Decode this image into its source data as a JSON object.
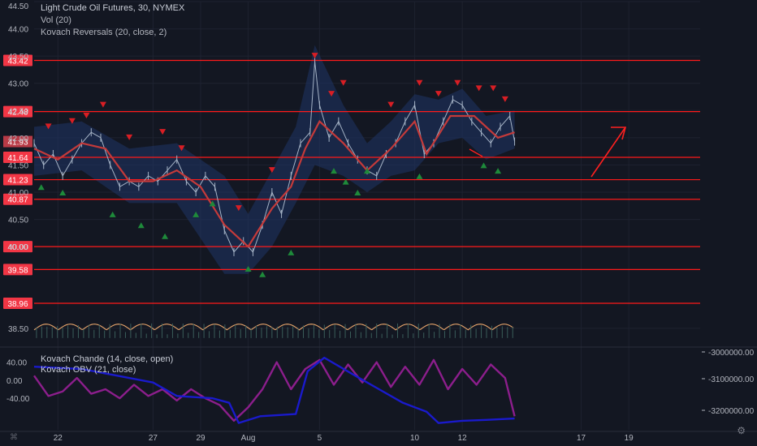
{
  "header": {
    "symbol_line": "Light Crude Oil Futures, 30, NYMEX",
    "vol_line": "Vol (20)",
    "reversals_line": "Kovach Reversals (20, close, 2)"
  },
  "sub_legend": {
    "chande": "Kovach Chande (14, close, open)",
    "obv": "Kovach OBV (21, close)"
  },
  "colors": {
    "background": "#131722",
    "grid": "#1e2230",
    "price_up": "#a5b3c6",
    "level_line": "#ff1a1a",
    "level_badge": "#f23645",
    "trend_line": "#c43a3a",
    "band": "#1f3566",
    "up_marker": "#1e8a3a",
    "down_marker": "#d81e24",
    "volume_wave": "#e8a56b",
    "chande_line": "#8c1e8c",
    "obv_line": "#1a1acc",
    "axis_text": "#b2b5be"
  },
  "chart_data": {
    "type": "line",
    "title": "Light Crude Oil Futures, 30, NYMEX",
    "price_axis": {
      "ylim": [
        38.2,
        44.5
      ],
      "ticks": [
        "44.50",
        "44.00",
        "43.50",
        "43.00",
        "42.50",
        "42.00",
        "41.50",
        "41.00",
        "40.50",
        "40.00",
        "38.50"
      ]
    },
    "x_ticks": [
      {
        "label": "22",
        "x": 1
      },
      {
        "label": "27",
        "x": 5
      },
      {
        "label": "29",
        "x": 7
      },
      {
        "label": "Aug",
        "x": 9
      },
      {
        "label": "5",
        "x": 12
      },
      {
        "label": "10",
        "x": 16
      },
      {
        "label": "12",
        "x": 18
      },
      {
        "label": "17",
        "x": 23
      },
      {
        "label": "19",
        "x": 25
      }
    ],
    "xlim": [
      0,
      28
    ],
    "horizontal_levels": [
      "43.42",
      "42.48",
      "41.64",
      "41.23",
      "40.87",
      "40.00",
      "39.58",
      "38.96"
    ],
    "last_price": "41.93",
    "price_series": [
      {
        "x": 0.0,
        "y": 41.9
      },
      {
        "x": 0.4,
        "y": 41.5
      },
      {
        "x": 0.8,
        "y": 41.7
      },
      {
        "x": 1.2,
        "y": 41.3
      },
      {
        "x": 1.6,
        "y": 41.6
      },
      {
        "x": 2.0,
        "y": 41.9
      },
      {
        "x": 2.4,
        "y": 42.1
      },
      {
        "x": 2.8,
        "y": 42.0
      },
      {
        "x": 3.2,
        "y": 41.5
      },
      {
        "x": 3.6,
        "y": 41.1
      },
      {
        "x": 4.0,
        "y": 41.2
      },
      {
        "x": 4.4,
        "y": 41.1
      },
      {
        "x": 4.8,
        "y": 41.3
      },
      {
        "x": 5.2,
        "y": 41.2
      },
      {
        "x": 5.6,
        "y": 41.4
      },
      {
        "x": 6.0,
        "y": 41.6
      },
      {
        "x": 6.4,
        "y": 41.2
      },
      {
        "x": 6.8,
        "y": 41.0
      },
      {
        "x": 7.2,
        "y": 41.3
      },
      {
        "x": 7.6,
        "y": 41.1
      },
      {
        "x": 8.0,
        "y": 40.3
      },
      {
        "x": 8.4,
        "y": 39.9
      },
      {
        "x": 8.8,
        "y": 40.1
      },
      {
        "x": 9.2,
        "y": 39.9
      },
      {
        "x": 9.6,
        "y": 40.4
      },
      {
        "x": 10.0,
        "y": 41.0
      },
      {
        "x": 10.4,
        "y": 40.6
      },
      {
        "x": 10.8,
        "y": 41.3
      },
      {
        "x": 11.2,
        "y": 41.9
      },
      {
        "x": 11.6,
        "y": 42.1
      },
      {
        "x": 11.8,
        "y": 43.4
      },
      {
        "x": 12.0,
        "y": 42.6
      },
      {
        "x": 12.4,
        "y": 42.0
      },
      {
        "x": 12.8,
        "y": 42.3
      },
      {
        "x": 13.2,
        "y": 41.9
      },
      {
        "x": 13.6,
        "y": 41.6
      },
      {
        "x": 14.0,
        "y": 41.4
      },
      {
        "x": 14.4,
        "y": 41.3
      },
      {
        "x": 14.8,
        "y": 41.7
      },
      {
        "x": 15.2,
        "y": 41.9
      },
      {
        "x": 15.6,
        "y": 42.3
      },
      {
        "x": 16.0,
        "y": 42.6
      },
      {
        "x": 16.4,
        "y": 41.7
      },
      {
        "x": 16.8,
        "y": 41.9
      },
      {
        "x": 17.2,
        "y": 42.3
      },
      {
        "x": 17.6,
        "y": 42.7
      },
      {
        "x": 18.0,
        "y": 42.6
      },
      {
        "x": 18.4,
        "y": 42.3
      },
      {
        "x": 18.8,
        "y": 42.1
      },
      {
        "x": 19.2,
        "y": 41.9
      },
      {
        "x": 19.6,
        "y": 42.2
      },
      {
        "x": 20.0,
        "y": 42.4
      },
      {
        "x": 20.2,
        "y": 41.93
      }
    ],
    "trend_series": [
      {
        "x": 0.0,
        "y": 41.8
      },
      {
        "x": 1.0,
        "y": 41.6
      },
      {
        "x": 2.0,
        "y": 41.9
      },
      {
        "x": 3.0,
        "y": 41.8
      },
      {
        "x": 4.0,
        "y": 41.2
      },
      {
        "x": 5.0,
        "y": 41.2
      },
      {
        "x": 6.0,
        "y": 41.4
      },
      {
        "x": 7.0,
        "y": 41.1
      },
      {
        "x": 8.0,
        "y": 40.4
      },
      {
        "x": 9.0,
        "y": 40.0
      },
      {
        "x": 10.0,
        "y": 40.7
      },
      {
        "x": 10.8,
        "y": 41.1
      },
      {
        "x": 11.4,
        "y": 41.8
      },
      {
        "x": 12.0,
        "y": 42.3
      },
      {
        "x": 13.0,
        "y": 41.9
      },
      {
        "x": 14.0,
        "y": 41.4
      },
      {
        "x": 15.0,
        "y": 41.8
      },
      {
        "x": 16.0,
        "y": 42.3
      },
      {
        "x": 16.5,
        "y": 41.7
      },
      {
        "x": 17.5,
        "y": 42.4
      },
      {
        "x": 18.5,
        "y": 42.4
      },
      {
        "x": 19.5,
        "y": 42.0
      },
      {
        "x": 20.2,
        "y": 42.1
      }
    ],
    "band_upper": [
      {
        "x": 0.0,
        "y": 42.2
      },
      {
        "x": 2.0,
        "y": 42.3
      },
      {
        "x": 4.0,
        "y": 41.8
      },
      {
        "x": 6.0,
        "y": 41.9
      },
      {
        "x": 8.0,
        "y": 41.3
      },
      {
        "x": 9.0,
        "y": 40.6
      },
      {
        "x": 10.0,
        "y": 41.4
      },
      {
        "x": 11.0,
        "y": 42.2
      },
      {
        "x": 11.8,
        "y": 43.7
      },
      {
        "x": 13.0,
        "y": 42.6
      },
      {
        "x": 14.0,
        "y": 41.9
      },
      {
        "x": 15.0,
        "y": 42.3
      },
      {
        "x": 16.0,
        "y": 42.8
      },
      {
        "x": 17.0,
        "y": 42.7
      },
      {
        "x": 18.0,
        "y": 42.9
      },
      {
        "x": 19.0,
        "y": 42.4
      },
      {
        "x": 20.2,
        "y": 42.5
      }
    ],
    "band_lower": [
      {
        "x": 0.0,
        "y": 41.3
      },
      {
        "x": 2.0,
        "y": 41.4
      },
      {
        "x": 4.0,
        "y": 40.8
      },
      {
        "x": 6.0,
        "y": 40.8
      },
      {
        "x": 8.0,
        "y": 39.5
      },
      {
        "x": 9.0,
        "y": 39.5
      },
      {
        "x": 10.0,
        "y": 40.0
      },
      {
        "x": 11.0,
        "y": 40.8
      },
      {
        "x": 11.8,
        "y": 41.5
      },
      {
        "x": 13.0,
        "y": 41.3
      },
      {
        "x": 14.0,
        "y": 41.0
      },
      {
        "x": 15.0,
        "y": 41.3
      },
      {
        "x": 16.0,
        "y": 41.4
      },
      {
        "x": 17.0,
        "y": 41.9
      },
      {
        "x": 18.0,
        "y": 42.0
      },
      {
        "x": 19.0,
        "y": 41.6
      },
      {
        "x": 20.2,
        "y": 41.8
      }
    ],
    "down_markers": [
      {
        "x": 0.6,
        "y": 42.2
      },
      {
        "x": 1.6,
        "y": 42.3
      },
      {
        "x": 2.2,
        "y": 42.4
      },
      {
        "x": 2.9,
        "y": 42.6
      },
      {
        "x": 4.0,
        "y": 42.0
      },
      {
        "x": 5.4,
        "y": 42.1
      },
      {
        "x": 6.2,
        "y": 41.8
      },
      {
        "x": 8.6,
        "y": 40.7
      },
      {
        "x": 10.0,
        "y": 41.4
      },
      {
        "x": 11.8,
        "y": 43.5
      },
      {
        "x": 12.5,
        "y": 42.8
      },
      {
        "x": 13.0,
        "y": 43.0
      },
      {
        "x": 15.0,
        "y": 42.6
      },
      {
        "x": 16.2,
        "y": 43.0
      },
      {
        "x": 17.0,
        "y": 42.8
      },
      {
        "x": 17.8,
        "y": 43.0
      },
      {
        "x": 18.7,
        "y": 42.9
      },
      {
        "x": 19.3,
        "y": 42.9
      },
      {
        "x": 19.8,
        "y": 42.7
      }
    ],
    "up_markers": [
      {
        "x": 0.3,
        "y": 41.1
      },
      {
        "x": 1.2,
        "y": 41.0
      },
      {
        "x": 3.3,
        "y": 40.6
      },
      {
        "x": 4.5,
        "y": 40.4
      },
      {
        "x": 5.5,
        "y": 40.2
      },
      {
        "x": 6.8,
        "y": 40.6
      },
      {
        "x": 7.5,
        "y": 40.8
      },
      {
        "x": 9.0,
        "y": 39.6
      },
      {
        "x": 9.6,
        "y": 39.5
      },
      {
        "x": 10.8,
        "y": 39.9
      },
      {
        "x": 12.6,
        "y": 41.4
      },
      {
        "x": 13.1,
        "y": 41.2
      },
      {
        "x": 13.6,
        "y": 41.0
      },
      {
        "x": 14.0,
        "y": 41.4
      },
      {
        "x": 16.2,
        "y": 41.3
      },
      {
        "x": 18.9,
        "y": 41.5
      },
      {
        "x": 19.5,
        "y": 41.4
      }
    ],
    "volume_wave_level": 0.45,
    "sub_axis_left_ticks": [
      "40.00",
      "0.00",
      "-40.00"
    ],
    "sub_axis_right_ticks": [
      "-3000000.00",
      "-3100000.00",
      "-3200000.00"
    ],
    "chande_series": [
      {
        "x": 0.0,
        "y": 10
      },
      {
        "x": 0.6,
        "y": -35
      },
      {
        "x": 1.2,
        "y": -25
      },
      {
        "x": 1.8,
        "y": 5
      },
      {
        "x": 2.4,
        "y": -30
      },
      {
        "x": 3.0,
        "y": -20
      },
      {
        "x": 3.6,
        "y": -40
      },
      {
        "x": 4.2,
        "y": -10
      },
      {
        "x": 4.8,
        "y": -35
      },
      {
        "x": 5.4,
        "y": -20
      },
      {
        "x": 6.0,
        "y": -45
      },
      {
        "x": 6.6,
        "y": -20
      },
      {
        "x": 7.2,
        "y": -40
      },
      {
        "x": 7.8,
        "y": -55
      },
      {
        "x": 8.4,
        "y": -90
      },
      {
        "x": 9.0,
        "y": -60
      },
      {
        "x": 9.6,
        "y": -20
      },
      {
        "x": 10.2,
        "y": 40
      },
      {
        "x": 10.8,
        "y": -20
      },
      {
        "x": 11.4,
        "y": 25
      },
      {
        "x": 12.0,
        "y": 45
      },
      {
        "x": 12.6,
        "y": -10
      },
      {
        "x": 13.2,
        "y": 35
      },
      {
        "x": 13.8,
        "y": -5
      },
      {
        "x": 14.4,
        "y": 40
      },
      {
        "x": 15.0,
        "y": -15
      },
      {
        "x": 15.6,
        "y": 30
      },
      {
        "x": 16.2,
        "y": -10
      },
      {
        "x": 16.8,
        "y": 45
      },
      {
        "x": 17.4,
        "y": -20
      },
      {
        "x": 18.0,
        "y": 25
      },
      {
        "x": 18.6,
        "y": -10
      },
      {
        "x": 19.2,
        "y": 35
      },
      {
        "x": 19.8,
        "y": 5
      },
      {
        "x": 20.2,
        "y": -80
      }
    ],
    "obv_series": [
      {
        "x": 0.0,
        "y": 30
      },
      {
        "x": 2.0,
        "y": 25
      },
      {
        "x": 3.5,
        "y": 10
      },
      {
        "x": 5.0,
        "y": -5
      },
      {
        "x": 6.0,
        "y": -35
      },
      {
        "x": 7.5,
        "y": -40
      },
      {
        "x": 8.2,
        "y": -50
      },
      {
        "x": 8.6,
        "y": -95
      },
      {
        "x": 9.5,
        "y": -80
      },
      {
        "x": 11.0,
        "y": -75
      },
      {
        "x": 11.5,
        "y": 20
      },
      {
        "x": 12.2,
        "y": 50
      },
      {
        "x": 13.5,
        "y": 10
      },
      {
        "x": 14.5,
        "y": -20
      },
      {
        "x": 15.5,
        "y": -50
      },
      {
        "x": 16.5,
        "y": -70
      },
      {
        "x": 17.0,
        "y": -95
      },
      {
        "x": 18.0,
        "y": -90
      },
      {
        "x": 19.0,
        "y": -88
      },
      {
        "x": 20.2,
        "y": -85
      }
    ],
    "sub_ylim": [
      -110,
      70
    ]
  }
}
